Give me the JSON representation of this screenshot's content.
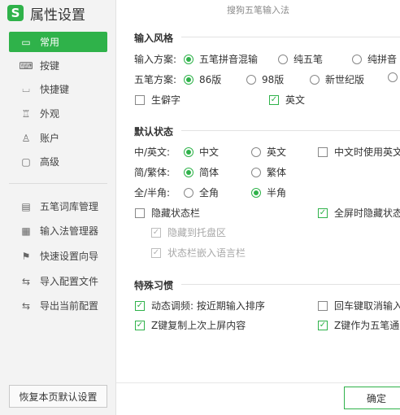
{
  "app": {
    "title": "属性设置",
    "logo_letter": "S",
    "window_title": "搜狗五笔输入法"
  },
  "nav": [
    {
      "label": "常用",
      "icon": "monitor-icon",
      "glyph": "▭",
      "active": true
    },
    {
      "label": "按键",
      "icon": "keyboard-icon",
      "glyph": "⌨",
      "active": false
    },
    {
      "label": "快捷键",
      "icon": "shortcut-icon",
      "glyph": "⌴",
      "active": false
    },
    {
      "label": "外观",
      "icon": "shirt-icon",
      "glyph": "♖",
      "active": false
    },
    {
      "label": "账户",
      "icon": "user-icon",
      "glyph": "♙",
      "active": false
    },
    {
      "label": "高级",
      "icon": "advanced-icon",
      "glyph": "▢",
      "active": false
    }
  ],
  "tools": [
    {
      "label": "五笔词库管理",
      "icon": "dictionary-icon",
      "glyph": "▤"
    },
    {
      "label": "输入法管理器",
      "icon": "manager-icon",
      "glyph": "▦"
    },
    {
      "label": "快速设置向导",
      "icon": "flag-icon",
      "glyph": "⚑"
    },
    {
      "label": "导入配置文件",
      "icon": "import-icon",
      "glyph": "⇆"
    },
    {
      "label": "导出当前配置",
      "icon": "export-icon",
      "glyph": "⇆"
    }
  ],
  "restore_button": "恢复本页默认设置",
  "ok_button": "确定",
  "sections": {
    "input_style": {
      "title": "输入风格",
      "scheme_label": "输入方案:",
      "scheme_options": [
        "五笔拼音混输",
        "纯五笔",
        "纯拼音"
      ],
      "wubi_label": "五笔方案:",
      "wubi_options": [
        "86版",
        "98版",
        "新世纪版"
      ],
      "rare_chars": "生僻字",
      "english": "英文"
    },
    "default_state": {
      "title": "默认状态",
      "cn_en_label": "中/英文:",
      "cn_en_options": [
        "中文",
        "英文"
      ],
      "cn_use_en_punct": "中文时使用英文标点",
      "simp_trad_label": "简/繁体:",
      "simp_trad_options": [
        "简体",
        "繁体"
      ],
      "width_label": "全/半角:",
      "width_options": [
        "全角",
        "半角"
      ],
      "hide_status_bar": "隐藏状态栏",
      "fullscreen_hide": "全屏时隐藏状态栏",
      "hide_to_tray": "隐藏到托盘区",
      "embed_language_bar": "状态栏嵌入语言栏"
    },
    "habits": {
      "title": "特殊习惯",
      "dynamic_adjust": "动态调频: 按近期输入排序",
      "enter_cancel": "回车键取消输入",
      "z_repeat": "Z键复制上次上屏内容",
      "z_wubi": "Z键作为五笔通配键"
    }
  },
  "colors": {
    "accent": "#2fb24a",
    "sidebar_bg": "#f3f3f3"
  }
}
